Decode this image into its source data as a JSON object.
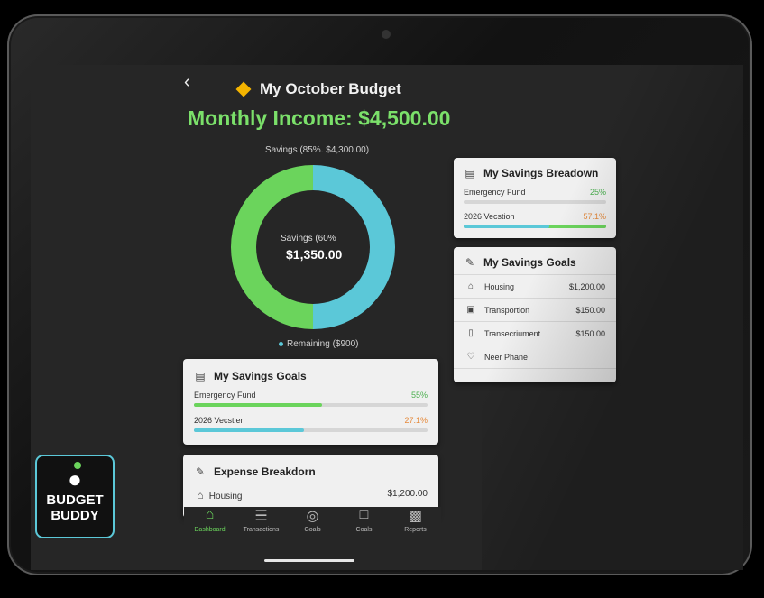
{
  "header": {
    "back_icon": "chevron-left",
    "title": "My October Budget",
    "income": "Monthly Income: $4,500.00"
  },
  "donut": {
    "top_label": "Savings (85%. $4,300.00)",
    "center_small": "Savings (60%",
    "center_big": "$1,350.00",
    "remaining_label": "Remaining ($900)",
    "colors": {
      "savings": "#6bd45c",
      "remaining": "#5bc8d8"
    },
    "savings_fraction": 0.5
  },
  "savings_goals_card": {
    "title": "My Savings Goals",
    "items": [
      {
        "name": "Emergency Fund",
        "pct": "55%",
        "fraction": 0.55,
        "color": "green"
      },
      {
        "name": "2026 Vecstien",
        "pct": "27.1%",
        "fraction": 0.47,
        "color": "teal"
      }
    ]
  },
  "expense_card": {
    "title": "Expense Breakdorn",
    "items": [
      {
        "name": "Housing",
        "amount": "$1,200.00"
      }
    ]
  },
  "right_breakdown": {
    "title": "My Savings Breadown",
    "items": [
      {
        "name": "Emergency Fund",
        "pct": "25%",
        "fraction": 0,
        "color": "green"
      },
      {
        "name": "2026 Vecstion",
        "pct": "57.1%",
        "fraction": 0.6,
        "color": "teal"
      }
    ]
  },
  "right_goals": {
    "title": "My Savings Goals",
    "items": [
      {
        "name": "Housing",
        "amount": "$1,200.00",
        "icon": "home-icon"
      },
      {
        "name": "Transportion",
        "amount": "$150.00",
        "icon": "car-icon"
      },
      {
        "name": "Transecriument",
        "amount": "$150.00",
        "icon": "clipboard-icon"
      },
      {
        "name": "Neer Phane",
        "amount": "",
        "icon": "tag-icon"
      }
    ]
  },
  "nav": [
    {
      "label": "Dashboard",
      "icon": "home-icon",
      "active": true
    },
    {
      "label": "Transactions",
      "icon": "list-icon",
      "active": false
    },
    {
      "label": "Goals",
      "icon": "target-icon",
      "active": false
    },
    {
      "label": "Coals",
      "icon": "chat-icon",
      "active": false
    },
    {
      "label": "Reports",
      "icon": "chart-icon",
      "active": false
    }
  ],
  "logo": {
    "line1": "BUDGET",
    "line2": "BUDDY"
  }
}
